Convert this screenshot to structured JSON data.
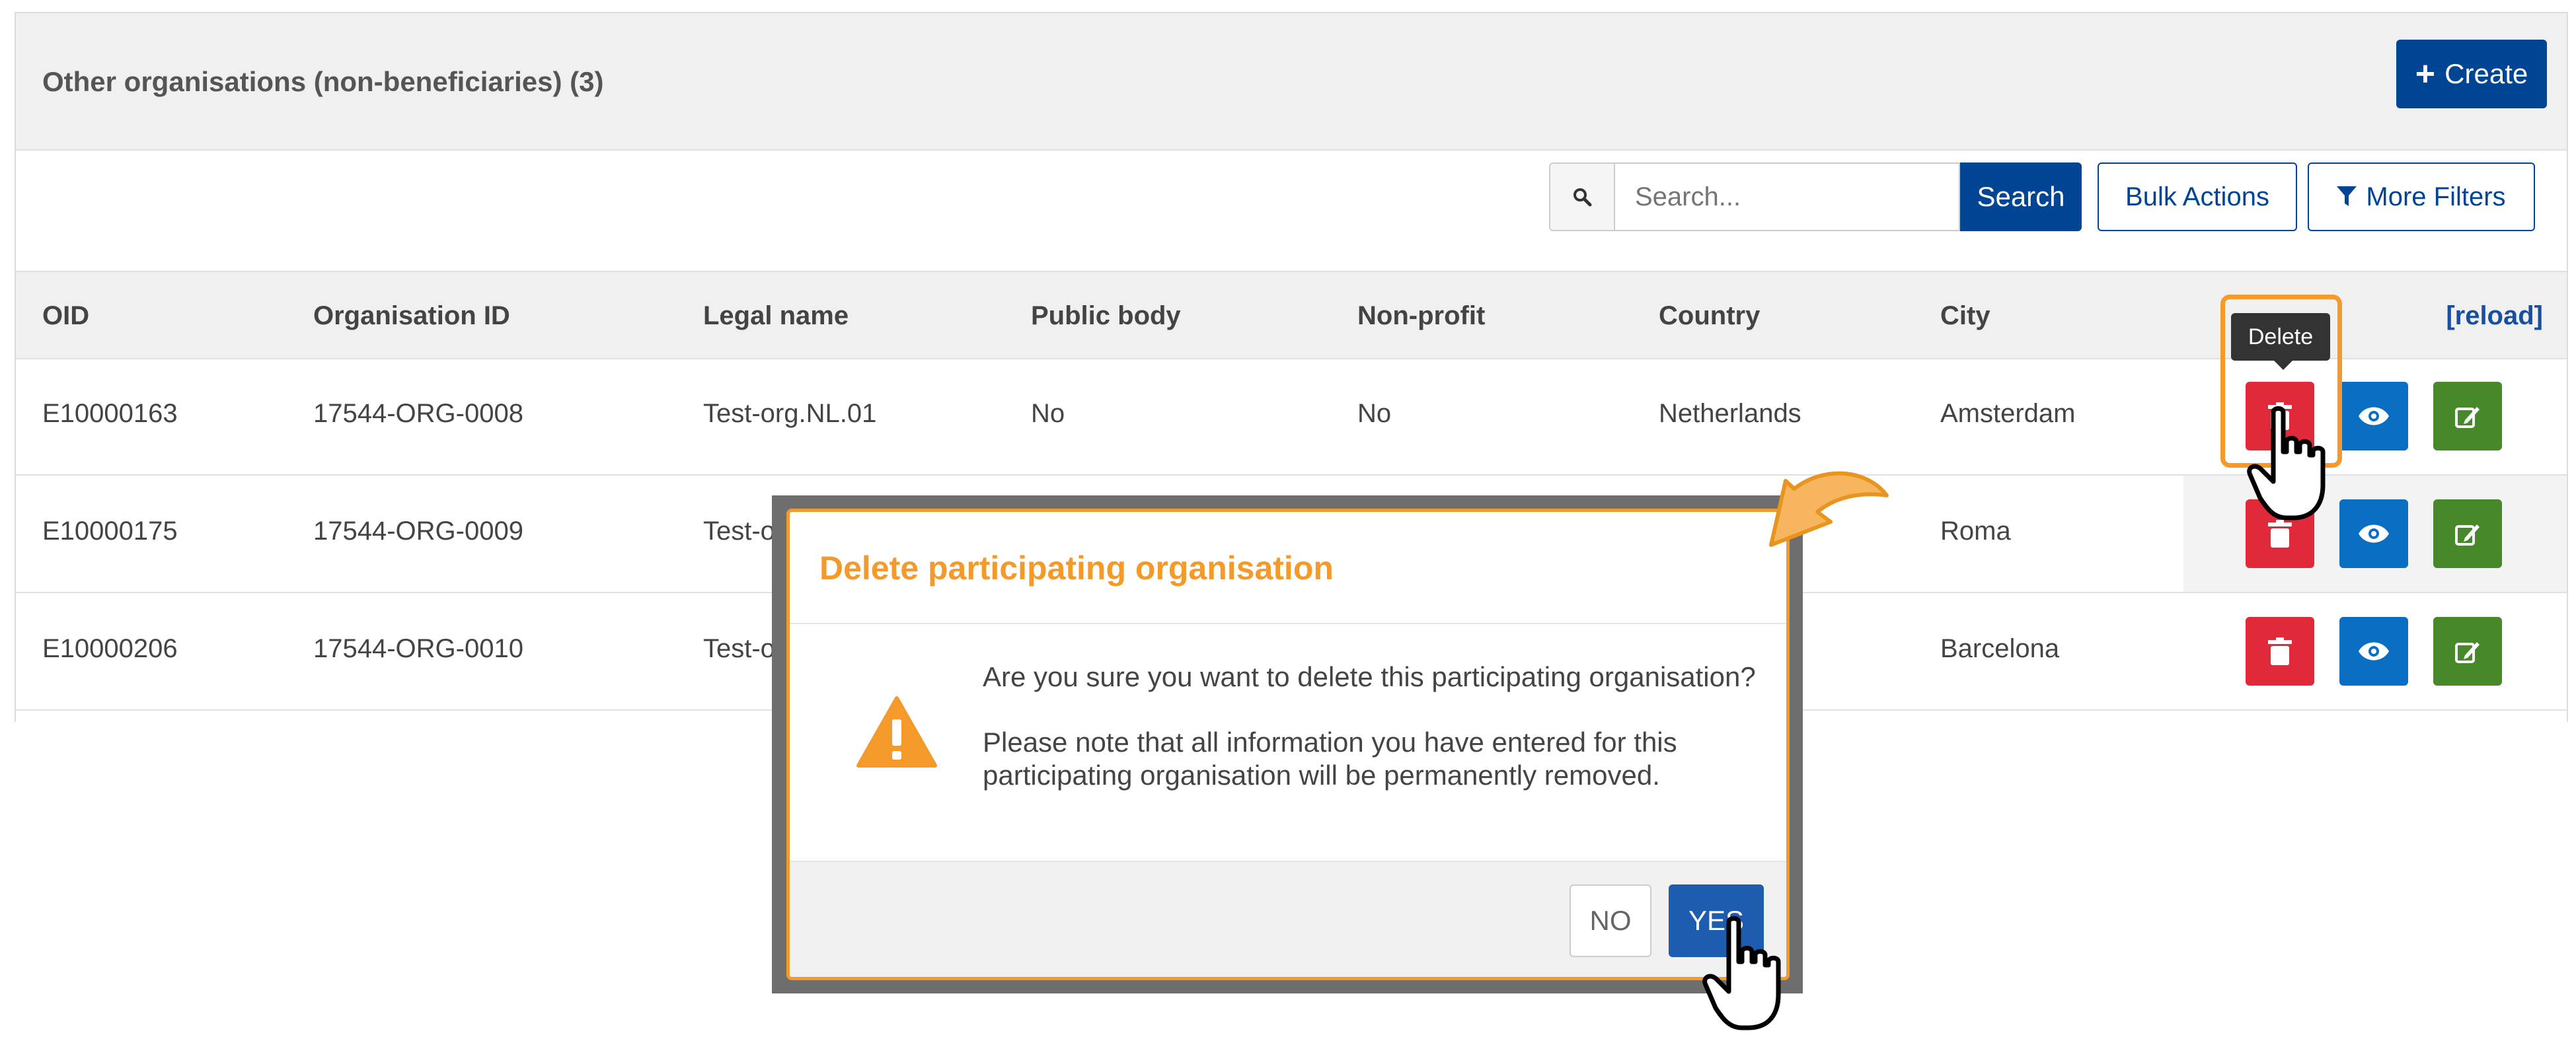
{
  "panel": {
    "title": "Other organisations (non-beneficiaries) (3)",
    "create_label": "Create"
  },
  "toolbar": {
    "search_placeholder": "Search...",
    "search_button": "Search",
    "bulk_actions": "Bulk Actions",
    "more_filters": "More Filters"
  },
  "table": {
    "columns": [
      "OID",
      "Organisation ID",
      "Legal name",
      "Public body",
      "Non-profit",
      "Country",
      "City"
    ],
    "reload": "[reload]",
    "rows": [
      {
        "oid": "E10000163",
        "org_id": "17544-ORG-0008",
        "legal_name": "Test-org.NL.01",
        "public_body": "No",
        "non_profit": "No",
        "country": "Netherlands",
        "city": "Amsterdam"
      },
      {
        "oid": "E10000175",
        "org_id": "17544-ORG-0009",
        "legal_name": "Test-o",
        "public_body": "",
        "non_profit": "",
        "country": "",
        "city": "Roma"
      },
      {
        "oid": "E10000206",
        "org_id": "17544-ORG-0010",
        "legal_name": "Test-o",
        "public_body": "",
        "non_profit": "",
        "country": "",
        "city": "Barcelona"
      }
    ]
  },
  "tooltip": {
    "delete": "Delete"
  },
  "modal": {
    "title": "Delete participating organisation",
    "question": "Are you sure you want to delete this participating organisation?",
    "note": "Please note that all information you have entered for this participating organisation will be permanently removed.",
    "no_label": "NO",
    "yes_label": "YES"
  },
  "colors": {
    "primary": "#004494",
    "delete": "#e02a3a",
    "view": "#0a6fc2",
    "edit": "#46882a",
    "highlight": "#f39a2b"
  }
}
